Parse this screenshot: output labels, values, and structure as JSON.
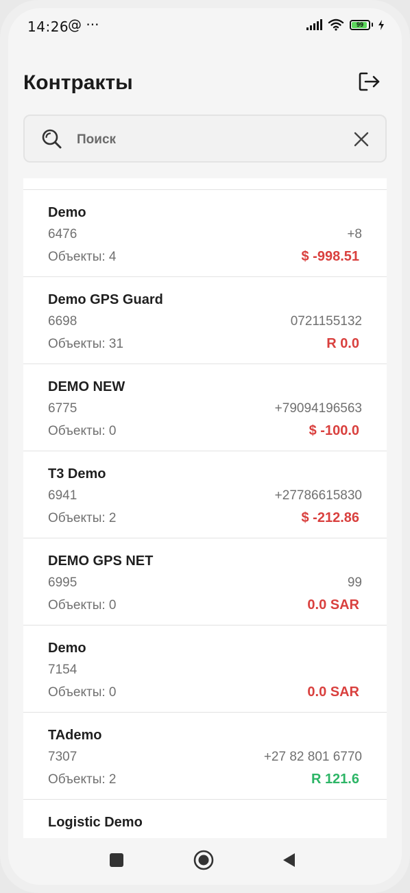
{
  "status": {
    "time": "14:26",
    "extra": "@ ···",
    "battery": "99"
  },
  "header": {
    "title": "Контракты"
  },
  "search": {
    "placeholder": "Поиск",
    "value": ""
  },
  "contracts": [
    {
      "name": "Demo",
      "id": "6476",
      "phone": "+8",
      "objects": "Объекты: 4",
      "balance": "$ -998.51",
      "balance_status": "negative"
    },
    {
      "name": "Demo GPS Guard",
      "id": "6698",
      "phone": "0721155132",
      "objects": "Объекты: 31",
      "balance": "R 0.0",
      "balance_status": "negative"
    },
    {
      "name": "DEMO NEW",
      "id": "6775",
      "phone": "+79094196563",
      "objects": "Объекты: 0",
      "balance": "$ -100.0",
      "balance_status": "negative"
    },
    {
      "name": "T3 Demo",
      "id": "6941",
      "phone": "+27786615830",
      "objects": "Объекты: 2",
      "balance": "$ -212.86",
      "balance_status": "negative"
    },
    {
      "name": "DEMO GPS NET",
      "id": "6995",
      "phone": "99",
      "objects": "Объекты: 0",
      "balance": "0.0 SAR",
      "balance_status": "negative"
    },
    {
      "name": "Demo",
      "id": "7154",
      "phone": "",
      "objects": "Объекты: 0",
      "balance": "0.0 SAR",
      "balance_status": "negative"
    },
    {
      "name": "TAdemo",
      "id": "7307",
      "phone": "+27 82 801 6770",
      "objects": "Объекты: 2",
      "balance": "R 121.6",
      "balance_status": "positive"
    },
    {
      "name": "Logistic Demo",
      "id": "",
      "phone": "",
      "objects": "",
      "balance": "",
      "balance_status": "negative"
    }
  ],
  "colors": {
    "negative": "#d9403e",
    "positive": "#2db566",
    "background": "#f5f5f5"
  },
  "icons": {
    "logout": "logout-icon",
    "search": "search-icon",
    "clear": "close-icon",
    "nav_recent": "square-icon",
    "nav_home": "home-circle-icon",
    "nav_back": "back-triangle-icon"
  }
}
